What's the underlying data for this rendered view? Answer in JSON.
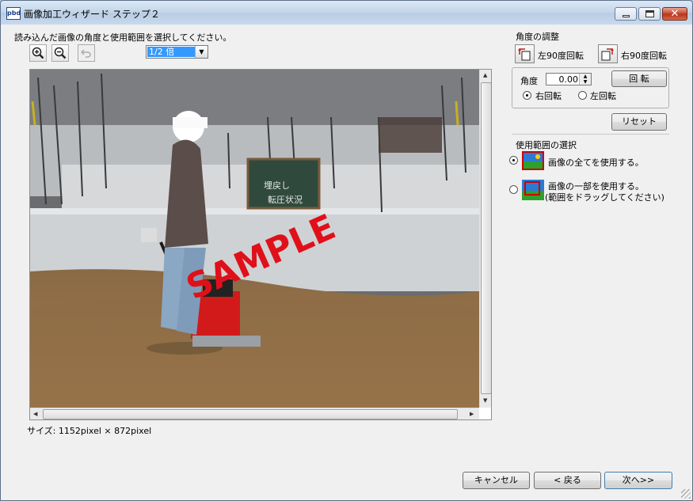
{
  "window": {
    "title": "画像加工ウィザード ステップ２",
    "app_icon_label": "pbd"
  },
  "instruction": "読み込んだ画像の角度と使用範囲を選択してください。",
  "toolbar": {
    "zoom_in_icon": "zoom-in-icon",
    "zoom_out_icon": "zoom-out-icon",
    "undo_icon": "undo-icon",
    "zoom_select": "1/2 倍"
  },
  "image": {
    "watermark": "SAMPLE",
    "sign_line1": "埋戻し",
    "sign_line2": "転圧状況"
  },
  "size_info": "サイズ: 1152pixel × 872pixel",
  "angle": {
    "section_title": "角度の調整",
    "rotate_left_90": "左90度回転",
    "rotate_right_90": "右90度回転",
    "angle_label": "角度",
    "angle_value": "0.00",
    "rotate_button": "回 転",
    "right_rotation": "右回転",
    "left_rotation": "左回転",
    "reset_button": "リセット"
  },
  "range": {
    "section_title": "使用範囲の選択",
    "option_all": "画像の全てを使用する。",
    "option_part_line1": "画像の一部を使用する。",
    "option_part_line2": "(範囲をドラッグしてください)"
  },
  "footer": {
    "cancel": "キャンセル",
    "back": "< 戻る",
    "next": "次へ>>"
  },
  "colors": {
    "selection": "#3399ff",
    "close_button": "#c7442a",
    "icon_frame": "#cc0000"
  }
}
